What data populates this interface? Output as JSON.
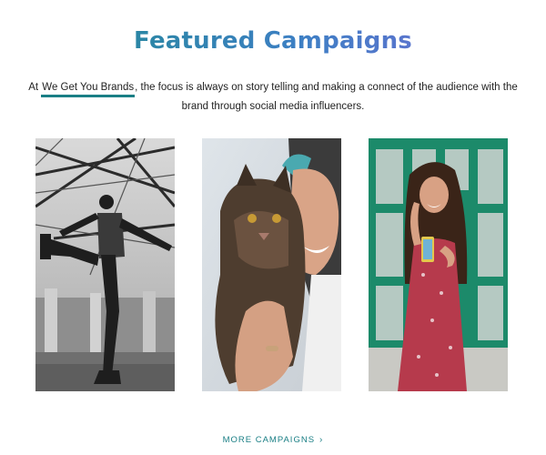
{
  "section": {
    "title": "Featured Campaigns",
    "intro_before": "At ",
    "intro_link": "We Get You Brands",
    "intro_after": ", the focus is always on story telling and making a connect of the audience with the brand through social media influencers."
  },
  "campaigns": [
    {
      "image": "man-dancing-in-warehouse-bw-photo"
    },
    {
      "image": "woman-hugging-cat-photo"
    },
    {
      "image": "woman-with-phone-green-window-photo"
    }
  ],
  "more_link": {
    "label": "MORE CAMPAIGNS",
    "icon": "arrow-right-icon"
  },
  "colors": {
    "title_gradient_start": "#1c8c8c",
    "title_gradient_end": "#7a6ad8",
    "accent": "#1a7f85"
  }
}
